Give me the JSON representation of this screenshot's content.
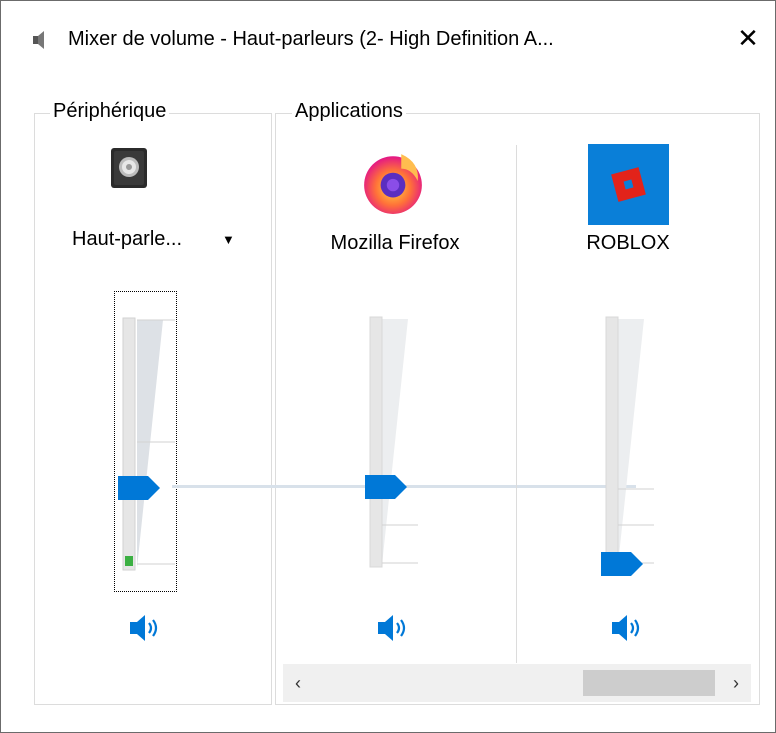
{
  "window": {
    "title": "Mixer de volume - Haut-parleurs (2- High Definition A...",
    "close_glyph": "✕",
    "title_icon": "speaker-icon"
  },
  "device": {
    "group_label": "Périphérique",
    "name": "Haut-parle...",
    "dropdown_glyph": "▼",
    "icon": "speaker-device-icon",
    "volume_percent": 33,
    "peak_level_percent": 3
  },
  "applications": {
    "group_label": "Applications",
    "items": [
      {
        "name": "Mozilla Firefox",
        "icon": "firefox-icon",
        "volume_percent": 33
      },
      {
        "name": "ROBLOX",
        "icon": "roblox-icon",
        "volume_percent": 1
      }
    ]
  },
  "scrollbar": {
    "left_glyph": "‹",
    "right_glyph": "›"
  },
  "colors": {
    "accent": "#0078d7",
    "track": "#e6e6e6",
    "peak_green": "#3cb043",
    "border": "#dcdcdc"
  }
}
